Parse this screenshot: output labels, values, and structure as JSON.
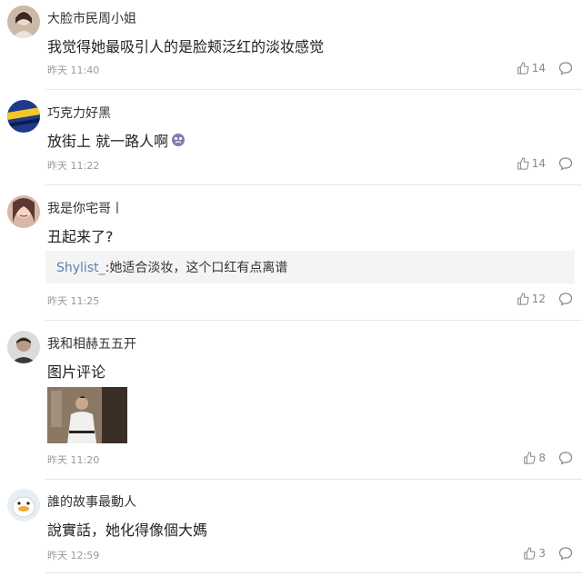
{
  "comments": [
    {
      "username": "大脸市民周小姐",
      "text": "我觉得她最吸引人的是脸颊泛红的淡妆感觉",
      "time": "昨天 11:40",
      "likes": "14",
      "avatar_icon": "girl-portrait-avatar"
    },
    {
      "username": "巧克力好黑",
      "text": "放街上 就一路人啊",
      "time": "昨天 11:22",
      "likes": "14",
      "avatar_icon": "blue-yellow-logo-avatar"
    },
    {
      "username": "我是你宅哥丨",
      "text": "丑起来了?",
      "time": "昨天 11:25",
      "likes": "12",
      "avatar_icon": "girl-portrait-avatar",
      "reply": {
        "user": "Shylist_",
        "text": ":她适合淡妆，这个口红有点离谱"
      }
    },
    {
      "username": "我和相赫五五开",
      "text": "图片评论",
      "time": "昨天 11:20",
      "likes": "8",
      "avatar_icon": "man-portrait-avatar",
      "image_icon": "comment-photo-thumbnail"
    },
    {
      "username": "誰的故事最動人",
      "text": "說實話，她化得像個大媽",
      "time": "昨天 12:59",
      "likes": "3",
      "avatar_icon": "duck-avatar"
    }
  ],
  "colors": {
    "reply_user": "#5b7fb0",
    "meta": "#999999",
    "divider": "#e6e6e6"
  }
}
